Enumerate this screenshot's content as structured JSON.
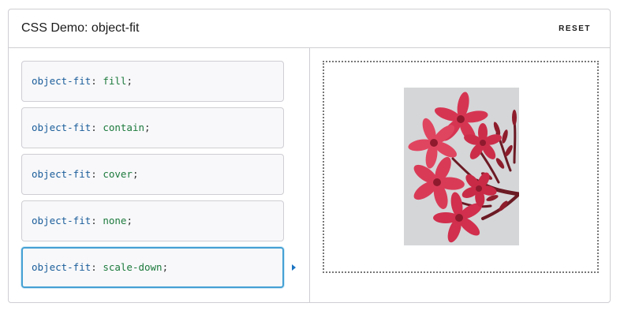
{
  "header": {
    "title": "CSS Demo: object-fit",
    "reset_label": "RESET"
  },
  "choices": [
    {
      "property": "object-fit",
      "colon": ":",
      "value": "fill",
      "semicolon": ";"
    },
    {
      "property": "object-fit",
      "colon": ":",
      "value": "contain",
      "semicolon": ";"
    },
    {
      "property": "object-fit",
      "colon": ":",
      "value": "cover",
      "semicolon": ";"
    },
    {
      "property": "object-fit",
      "colon": ":",
      "value": "none",
      "semicolon": ";"
    },
    {
      "property": "object-fit",
      "colon": ":",
      "value": "scale-down",
      "semicolon": ";"
    }
  ],
  "selected_index": 4,
  "output": {
    "image_icon": "pink-flower-branch-photo"
  },
  "colors": {
    "property": "#1a5d9a",
    "value": "#1c7a3c",
    "selected_border": "#45a1d4",
    "flower": "#d63552",
    "photo_background": "#d5d6d8"
  }
}
